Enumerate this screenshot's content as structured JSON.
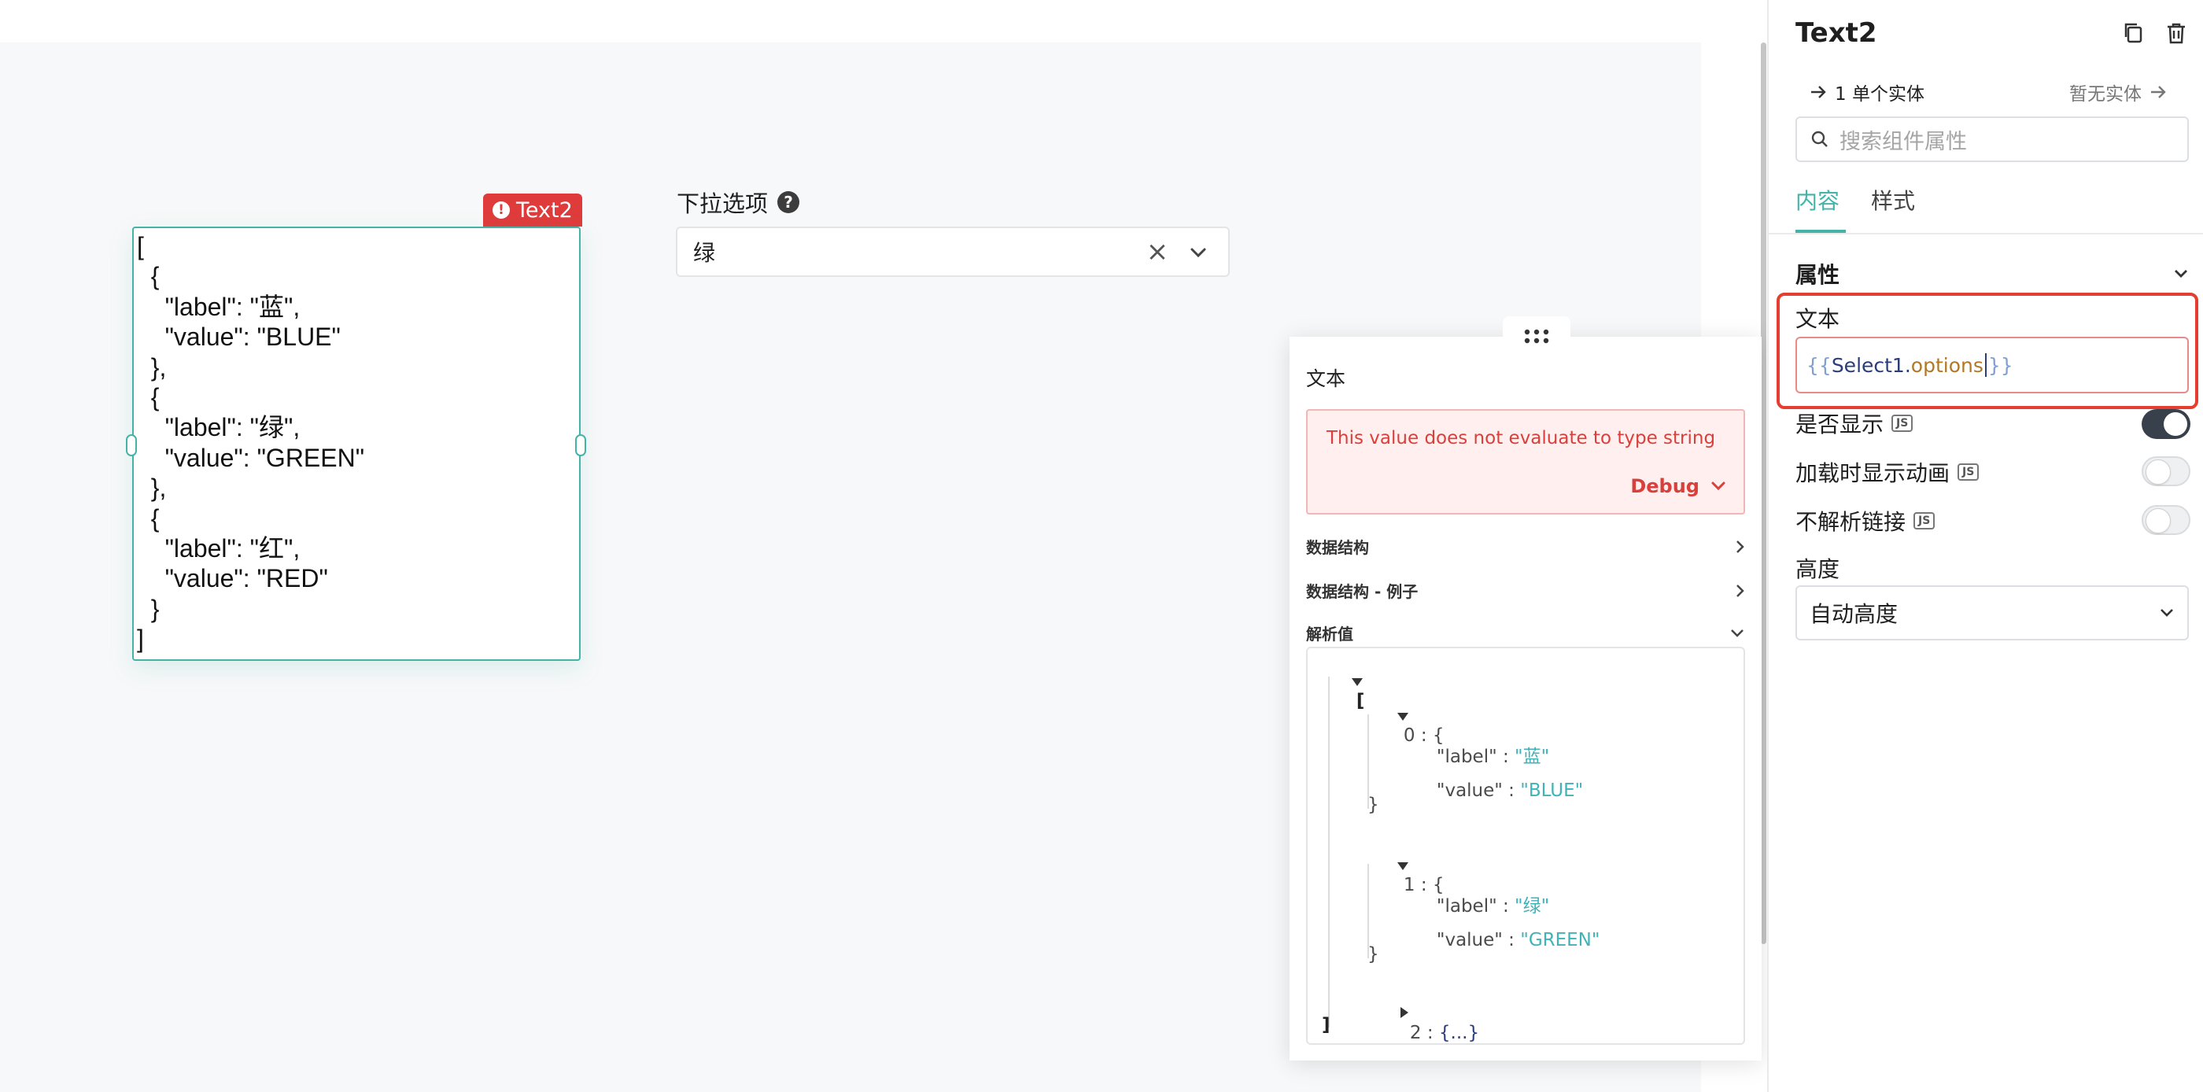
{
  "canvas": {
    "text_widget": {
      "tag_label": "Text2",
      "content": "[\n  {\n    \"label\": \"蓝\",\n    \"value\": \"BLUE\"\n  },\n  {\n    \"label\": \"绿\",\n    \"value\": \"GREEN\"\n  },\n  {\n    \"label\": \"红\",\n    \"value\": \"RED\"\n  }\n]"
    },
    "select_widget": {
      "label": "下拉选项",
      "value": "绿"
    }
  },
  "eval_popup": {
    "title": "文本",
    "error_message": "This value does not evaluate to type string",
    "debug_label": "Debug",
    "sections": {
      "data_structure": "数据结构",
      "data_structure_example": "数据结构 - 例子",
      "parsed_value": "解析值"
    },
    "tree": {
      "open_bracket": "[",
      "close_bracket": "]",
      "items": [
        {
          "index": "0",
          "open": "{",
          "close": "}",
          "label_key": "\"label\"",
          "label_val": "\"蓝\"",
          "value_key": "\"value\"",
          "value_val": "\"BLUE\""
        },
        {
          "index": "1",
          "open": "{",
          "close": "}",
          "label_key": "\"label\"",
          "label_val": "\"绿\"",
          "value_key": "\"value\"",
          "value_val": "\"GREEN\""
        }
      ],
      "collapsed_item": {
        "index": "2",
        "summary": "{...}"
      },
      "separator": " : "
    }
  },
  "panel": {
    "title": "Text2",
    "breadcrumb_left": "1 单个实体",
    "breadcrumb_right": "暂无实体",
    "search_placeholder": "搜索组件属性",
    "tabs": [
      "内容",
      "样式"
    ],
    "section_title": "属性",
    "text_field": {
      "label": "文本",
      "open_brace": "{{",
      "identifier": "Select1",
      "dot": ".",
      "property": "options",
      "close_brace": "}}"
    },
    "toggles": [
      {
        "label": "是否显示",
        "badge": "JS",
        "on": true
      },
      {
        "label": "加载时显示动画",
        "badge": "JS",
        "on": false
      },
      {
        "label": "不解析链接",
        "badge": "JS",
        "on": false
      }
    ],
    "height": {
      "label": "高度",
      "value": "自动高度"
    }
  }
}
